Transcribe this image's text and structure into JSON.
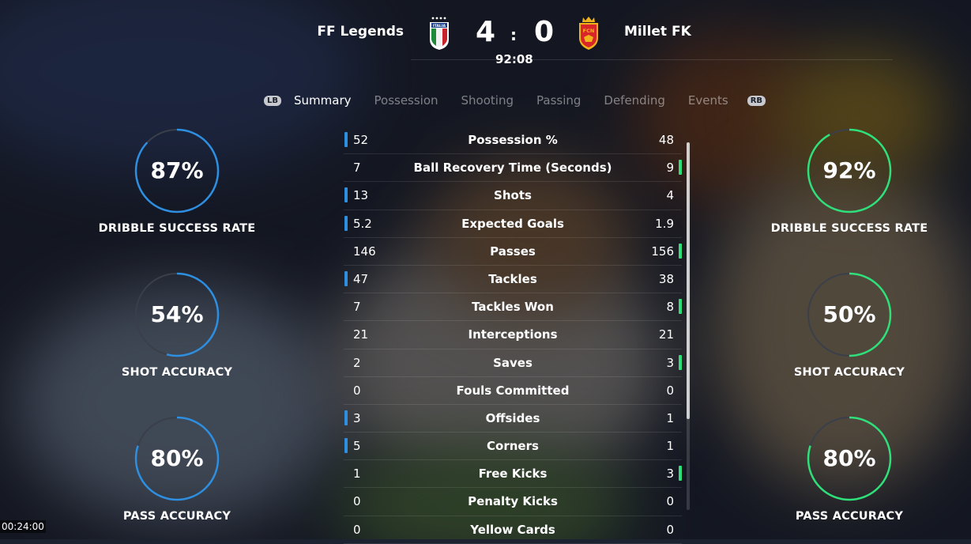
{
  "match": {
    "home_team": "FF Legends",
    "away_team": "Millet FK",
    "home_score": "4",
    "away_score": "0",
    "separator": ":",
    "clock": "92:08",
    "home_crest": "italia-crest-icon",
    "home_crest_text": "ITALIA",
    "away_crest": "fcn-crest-icon",
    "away_crest_text": "FCN"
  },
  "tabs": {
    "left_bumper": "LB",
    "right_bumper": "RB",
    "items": [
      "Summary",
      "Possession",
      "Shooting",
      "Passing",
      "Defending",
      "Events"
    ],
    "active": "Summary"
  },
  "home_rings": [
    {
      "value": "87%",
      "label": "DRIBBLE SUCCESS RATE",
      "fraction": 0.87
    },
    {
      "value": "54%",
      "label": "SHOT ACCURACY",
      "fraction": 0.54
    },
    {
      "value": "80%",
      "label": "PASS ACCURACY",
      "fraction": 0.8
    }
  ],
  "away_rings": [
    {
      "value": "92%",
      "label": "DRIBBLE SUCCESS RATE",
      "fraction": 0.92
    },
    {
      "value": "50%",
      "label": "SHOT ACCURACY",
      "fraction": 0.5
    },
    {
      "value": "80%",
      "label": "PASS ACCURACY",
      "fraction": 0.8
    }
  ],
  "stats": [
    {
      "label": "Possession %",
      "home": "52",
      "away": "48",
      "leader": "home"
    },
    {
      "label": "Ball Recovery Time (Seconds)",
      "home": "7",
      "away": "9",
      "leader": "away"
    },
    {
      "label": "Shots",
      "home": "13",
      "away": "4",
      "leader": "home"
    },
    {
      "label": "Expected Goals",
      "home": "5.2",
      "away": "1.9",
      "leader": "home"
    },
    {
      "label": "Passes",
      "home": "146",
      "away": "156",
      "leader": "away"
    },
    {
      "label": "Tackles",
      "home": "47",
      "away": "38",
      "leader": "home"
    },
    {
      "label": "Tackles Won",
      "home": "7",
      "away": "8",
      "leader": "away"
    },
    {
      "label": "Interceptions",
      "home": "21",
      "away": "21",
      "leader": "none"
    },
    {
      "label": "Saves",
      "home": "2",
      "away": "3",
      "leader": "away"
    },
    {
      "label": "Fouls Committed",
      "home": "0",
      "away": "0",
      "leader": "none"
    },
    {
      "label": "Offsides",
      "home": "3",
      "away": "1",
      "leader": "home"
    },
    {
      "label": "Corners",
      "home": "5",
      "away": "1",
      "leader": "home"
    },
    {
      "label": "Free Kicks",
      "home": "1",
      "away": "3",
      "leader": "away"
    },
    {
      "label": "Penalty Kicks",
      "home": "0",
      "away": "0",
      "leader": "none"
    },
    {
      "label": "Yellow Cards",
      "home": "0",
      "away": "0",
      "leader": "none"
    }
  ],
  "video_timestamp": "00:24:00",
  "colors": {
    "home_accent": "#2e8fe0",
    "away_accent": "#2fe07a",
    "ring_track": "#3a3f4a"
  }
}
